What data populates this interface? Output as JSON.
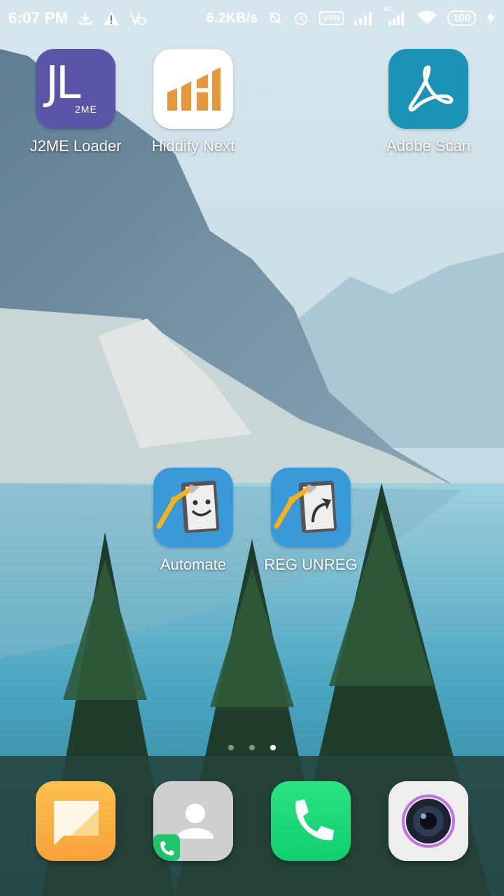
{
  "status_bar": {
    "time": "6:07 PM",
    "left_icons": [
      "download-icon",
      "warning-icon",
      "volte-icon"
    ],
    "network_speed": "6.2KB/s",
    "vpn_label": "VPN",
    "network_type": "4G",
    "battery_level": "100",
    "right_icons": [
      "mute-bell-icon",
      "alarm-icon",
      "signal-icon",
      "signal-4g-icon",
      "wifi-icon",
      "charging-icon"
    ]
  },
  "home_apps": [
    {
      "label": "J2ME Loader",
      "icon": "j2me-loader-icon"
    },
    {
      "label": "Hiddify Next",
      "icon": "hiddify-icon"
    },
    {
      "label": "Adobe Scan",
      "icon": "adobe-scan-icon"
    },
    {
      "label": "Automate",
      "icon": "automate-icon"
    },
    {
      "label": "REG UNREG",
      "icon": "reg-unreg-icon"
    }
  ],
  "icon_text": {
    "j2me": "JL",
    "j2me_sub": "2ME"
  },
  "page_indicator": {
    "pages": 3,
    "active": 3
  },
  "dock": [
    {
      "icon": "messages-icon"
    },
    {
      "icon": "contacts-icon"
    },
    {
      "icon": "phone-icon"
    },
    {
      "icon": "camera-icon"
    }
  ],
  "colors": {
    "j2me_bg": "#5b55a8",
    "hiddify_bg": "#ffffff",
    "hiddify_accent": "#e8963a",
    "adobe_bg": "#1a93b6",
    "automate_bg": "#3a9ad9",
    "messages_bg": "#fbb441",
    "contacts_bg": "#cfcfcf",
    "phone_bg": "#1ed97b",
    "camera_bg": "#eeeeee"
  }
}
